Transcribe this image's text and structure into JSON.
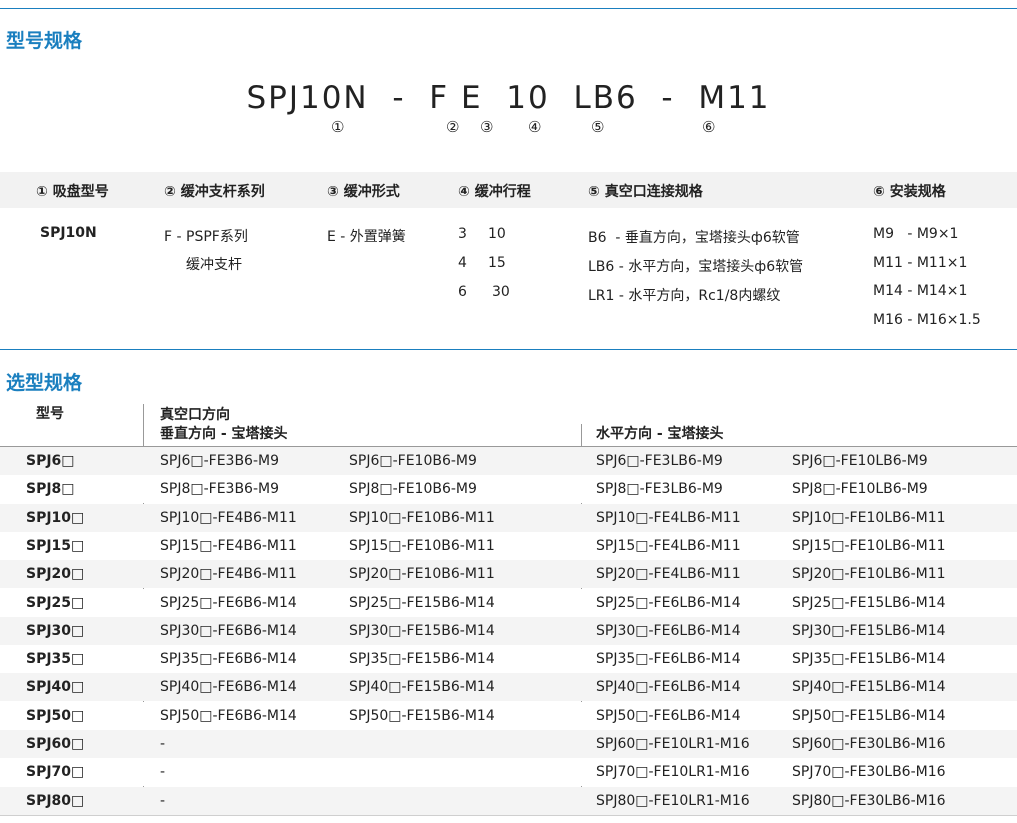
{
  "section1": {
    "title": "型号规格"
  },
  "model_code": {
    "parts": [
      "SPJ10N",
      "-",
      "F",
      "E",
      "10",
      "LB6",
      "-",
      "M11"
    ],
    "markers": [
      "①",
      "②",
      "③",
      "④",
      "⑤",
      "⑥"
    ]
  },
  "spec_table": {
    "headers": [
      "① 吸盘型号",
      "② 缓冲支杆系列",
      "③ 缓冲形式",
      "④ 缓冲行程",
      "⑤ 真空口连接规格",
      "⑥ 安装规格"
    ],
    "col1": [
      "SPJ10N"
    ],
    "col2": [
      "F - PSPF系列",
      "缓冲支杆"
    ],
    "col3": [
      "E - 外置弹簧"
    ],
    "col4": [
      [
        "3",
        "10"
      ],
      [
        "4",
        "15"
      ],
      [
        "6",
        "30"
      ]
    ],
    "col5": [
      "B6  - 垂直方向，宝塔接头ф6软管",
      "LB6 - 水平方向，宝塔接头ф6软管",
      "LR1 - 水平方向，Rc1/8内螺纹"
    ],
    "col6": [
      "M9   - M9×1",
      "M11 - M11×1",
      "M14 - M14×1",
      "M16 - M16×1.5"
    ]
  },
  "section2": {
    "title": "选型规格"
  },
  "select_table": {
    "header_model": "型号",
    "header_port": "真空口方向",
    "header_vertical": "垂直方向 - 宝塔接头",
    "header_horizontal": "水平方向 - 宝塔接头",
    "rows": [
      [
        "SPJ6□",
        "SPJ6□-FE3B6-M9",
        "SPJ6□-FE10B6-M9",
        "SPJ6□-FE3LB6-M9",
        "SPJ6□-FE10LB6-M9"
      ],
      [
        "SPJ8□",
        "SPJ8□-FE3B6-M9",
        "SPJ8□-FE10B6-M9",
        "SPJ8□-FE3LB6-M9",
        "SPJ8□-FE10LB6-M9"
      ],
      [
        "SPJ10□",
        "SPJ10□-FE4B6-M11",
        "SPJ10□-FE10B6-M11",
        "SPJ10□-FE4LB6-M11",
        "SPJ10□-FE10LB6-M11"
      ],
      [
        "SPJ15□",
        "SPJ15□-FE4B6-M11",
        "SPJ15□-FE10B6-M11",
        "SPJ15□-FE4LB6-M11",
        "SPJ15□-FE10LB6-M11"
      ],
      [
        "SPJ20□",
        "SPJ20□-FE4B6-M11",
        "SPJ20□-FE10B6-M11",
        "SPJ20□-FE4LB6-M11",
        "SPJ20□-FE10LB6-M11"
      ],
      [
        "SPJ25□",
        "SPJ25□-FE6B6-M14",
        "SPJ25□-FE15B6-M14",
        "SPJ25□-FE6LB6-M14",
        "SPJ25□-FE15LB6-M14"
      ],
      [
        "SPJ30□",
        "SPJ30□-FE6B6-M14",
        "SPJ30□-FE15B6-M14",
        "SPJ30□-FE6LB6-M14",
        "SPJ30□-FE15LB6-M14"
      ],
      [
        "SPJ35□",
        "SPJ35□-FE6B6-M14",
        "SPJ35□-FE15B6-M14",
        "SPJ35□-FE6LB6-M14",
        "SPJ35□-FE15LB6-M14"
      ],
      [
        "SPJ40□",
        "SPJ40□-FE6B6-M14",
        "SPJ40□-FE15B6-M14",
        "SPJ40□-FE6LB6-M14",
        "SPJ40□-FE15LB6-M14"
      ],
      [
        "SPJ50□",
        "SPJ50□-FE6B6-M14",
        "SPJ50□-FE15B6-M14",
        "SPJ50□-FE6LB6-M14",
        "SPJ50□-FE15LB6-M14"
      ],
      [
        "SPJ60□",
        "-",
        "",
        "SPJ60□-FE10LR1-M16",
        "SPJ60□-FE30LB6-M16"
      ],
      [
        "SPJ70□",
        "-",
        "",
        "SPJ70□-FE10LR1-M16",
        "SPJ70□-FE30LB6-M16"
      ],
      [
        "SPJ80□",
        "-",
        "",
        "SPJ80□-FE10LR1-M16",
        "SPJ80□-FE30LB6-M16"
      ]
    ]
  },
  "colors": {
    "accent": "#1a7fbf",
    "header_bg": "#f2f2f2"
  }
}
